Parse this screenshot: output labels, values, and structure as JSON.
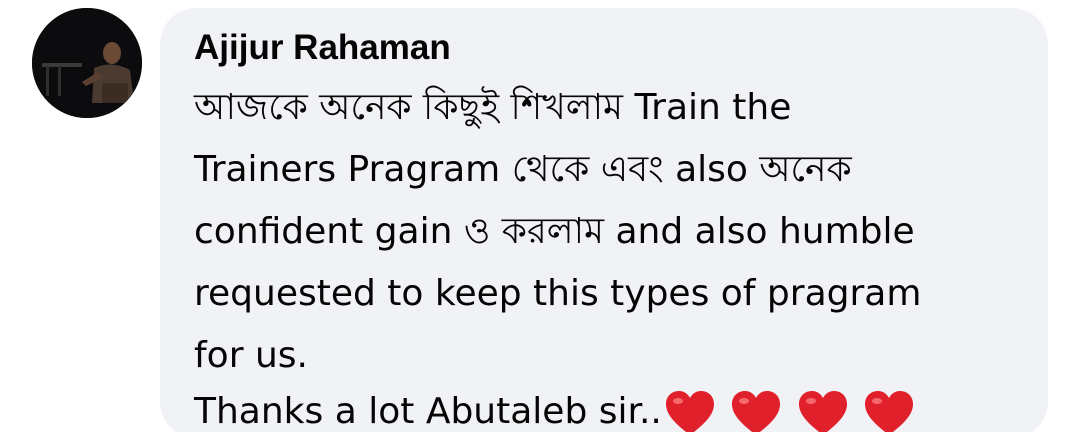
{
  "comment": {
    "author": "Ajijur Rahaman",
    "lines": [
      "আজকে অনেক কিছুই শিখলাম Train the",
      "Trainers Pragram থেকে এবং also অনেক",
      "confident gain ও করলাম and also humble",
      "requested to keep this types of pragram",
      "for us.",
      "Thanks a lot Abutaleb sir.."
    ],
    "reaction_icons": [
      "heart-emoji",
      "heart-emoji",
      "heart-emoji",
      "heart-emoji"
    ]
  },
  "colors": {
    "bubble": "#f0f2f5",
    "text": "#050505",
    "heart": "#e0202a"
  }
}
